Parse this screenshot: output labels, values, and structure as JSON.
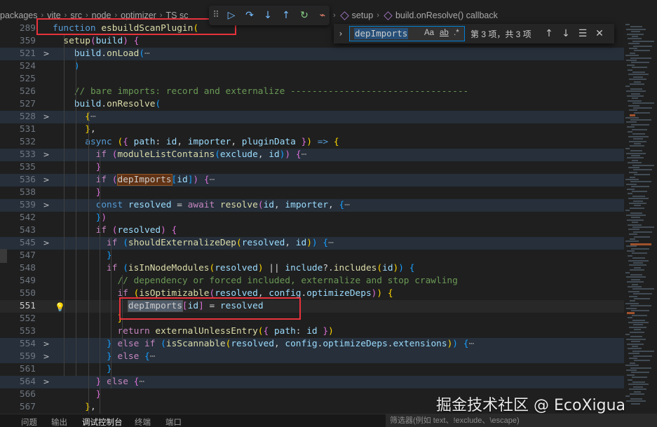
{
  "breadcrumb": {
    "items": [
      "packages",
      "vite",
      "src",
      "node",
      "optimizer",
      "TS sc"
    ],
    "tail": [
      "setup",
      "build.onResolve() callback"
    ]
  },
  "debug_toolbar": {
    "icons": [
      "grip-icon",
      "continue-icon",
      "step-over-icon",
      "step-into-icon",
      "step-out-icon",
      "restart-icon",
      "disconnect-icon"
    ]
  },
  "find": {
    "query": "depImports",
    "match_case": "Aa",
    "whole_word": "ab",
    "regex": ".*",
    "result": "第 3 项，共 3 项"
  },
  "editor": {
    "lines": [
      {
        "num": "289",
        "fold": "",
        "code": [
          [
            "kw",
            "function "
          ],
          [
            "fn",
            "esbuildScanPlugin"
          ],
          [
            "br1",
            "("
          ]
        ]
      },
      {
        "num": "359",
        "fold": "",
        "code": [
          [
            "pl",
            "  "
          ],
          [
            "fn",
            "setup"
          ],
          [
            "br2",
            "("
          ],
          [
            "var",
            "build"
          ],
          [
            "br2",
            ")"
          ],
          [
            "pl",
            " "
          ],
          [
            "br2",
            "{"
          ]
        ]
      },
      {
        "num": "521",
        "fold": ">",
        "folded": true,
        "code": [
          [
            "pl",
            "    "
          ],
          [
            "var",
            "build"
          ],
          [
            "pl",
            "."
          ],
          [
            "fn",
            "onLoad"
          ],
          [
            "br3",
            "("
          ],
          [
            "ellipsis",
            "⋯"
          ]
        ]
      },
      {
        "num": "524",
        "fold": "",
        "code": [
          [
            "pl",
            "    "
          ],
          [
            "br3",
            ")"
          ]
        ]
      },
      {
        "num": "525",
        "fold": "",
        "code": [
          [
            "pl",
            ""
          ]
        ]
      },
      {
        "num": "526",
        "fold": "",
        "code": [
          [
            "pl",
            "    "
          ],
          [
            "cm",
            "// bare imports: record and externalize ---------------------------------"
          ]
        ]
      },
      {
        "num": "527",
        "fold": "",
        "code": [
          [
            "pl",
            "    "
          ],
          [
            "var",
            "build"
          ],
          [
            "pl",
            "."
          ],
          [
            "fn",
            "onResolve"
          ],
          [
            "br3",
            "("
          ]
        ]
      },
      {
        "num": "528",
        "fold": ">",
        "folded": true,
        "code": [
          [
            "pl",
            "      "
          ],
          [
            "br1",
            "{"
          ],
          [
            "ellipsis",
            "⋯"
          ]
        ]
      },
      {
        "num": "531",
        "fold": "",
        "code": [
          [
            "pl",
            "      "
          ],
          [
            "br1",
            "}"
          ],
          [
            "pl",
            ","
          ]
        ]
      },
      {
        "num": "532",
        "fold": "",
        "code": [
          [
            "pl",
            "      "
          ],
          [
            "kw",
            "async"
          ],
          [
            "pl",
            " "
          ],
          [
            "br1",
            "("
          ],
          [
            "br2",
            "{"
          ],
          [
            "pl",
            " "
          ],
          [
            "var",
            "path"
          ],
          [
            "pl",
            ": "
          ],
          [
            "var",
            "id"
          ],
          [
            "pl",
            ", "
          ],
          [
            "var",
            "importer"
          ],
          [
            "pl",
            ", "
          ],
          [
            "var",
            "pluginData"
          ],
          [
            "pl",
            " "
          ],
          [
            "br2",
            "}"
          ],
          [
            "br1",
            ")"
          ],
          [
            "pl",
            " "
          ],
          [
            "kw",
            "=>"
          ],
          [
            "pl",
            " "
          ],
          [
            "br1",
            "{"
          ]
        ]
      },
      {
        "num": "533",
        "fold": ">",
        "folded": true,
        "code": [
          [
            "pl",
            "        "
          ],
          [
            "ctl",
            "if"
          ],
          [
            "pl",
            " "
          ],
          [
            "br2",
            "("
          ],
          [
            "fn",
            "moduleListContains"
          ],
          [
            "br3",
            "("
          ],
          [
            "var",
            "exclude"
          ],
          [
            "pl",
            ", "
          ],
          [
            "var",
            "id"
          ],
          [
            "br3",
            ")"
          ],
          [
            "br2",
            ")"
          ],
          [
            "pl",
            " "
          ],
          [
            "br2",
            "{"
          ],
          [
            "ellipsis",
            "⋯"
          ]
        ]
      },
      {
        "num": "535",
        "fold": "",
        "code": [
          [
            "pl",
            "        "
          ],
          [
            "br2",
            "}"
          ]
        ]
      },
      {
        "num": "536",
        "fold": ">",
        "folded": true,
        "code": [
          [
            "pl",
            "        "
          ],
          [
            "ctl",
            "if"
          ],
          [
            "pl",
            " "
          ],
          [
            "br2",
            "("
          ],
          [
            "hl",
            "depImports"
          ],
          [
            "br3",
            "["
          ],
          [
            "var",
            "id"
          ],
          [
            "br3",
            "]"
          ],
          [
            "br2",
            ")"
          ],
          [
            "pl",
            " "
          ],
          [
            "br2",
            "{"
          ],
          [
            "ellipsis",
            "⋯"
          ]
        ]
      },
      {
        "num": "538",
        "fold": "",
        "code": [
          [
            "pl",
            "        "
          ],
          [
            "br2",
            "}"
          ]
        ]
      },
      {
        "num": "539",
        "fold": ">",
        "folded": true,
        "code": [
          [
            "pl",
            "        "
          ],
          [
            "kw",
            "const"
          ],
          [
            "pl",
            " "
          ],
          [
            "var",
            "resolved"
          ],
          [
            "pl",
            " = "
          ],
          [
            "ctl",
            "await"
          ],
          [
            "pl",
            " "
          ],
          [
            "fn",
            "resolve"
          ],
          [
            "br2",
            "("
          ],
          [
            "var",
            "id"
          ],
          [
            "pl",
            ", "
          ],
          [
            "var",
            "importer"
          ],
          [
            "pl",
            ", "
          ],
          [
            "br3",
            "{"
          ],
          [
            "ellipsis",
            "⋯"
          ]
        ]
      },
      {
        "num": "542",
        "fold": "",
        "code": [
          [
            "pl",
            "        "
          ],
          [
            "br3",
            "}"
          ],
          [
            "br2",
            ")"
          ]
        ]
      },
      {
        "num": "543",
        "fold": "",
        "code": [
          [
            "pl",
            "        "
          ],
          [
            "ctl",
            "if"
          ],
          [
            "pl",
            " "
          ],
          [
            "br2",
            "("
          ],
          [
            "var",
            "resolved"
          ],
          [
            "br2",
            ")"
          ],
          [
            "pl",
            " "
          ],
          [
            "br2",
            "{"
          ]
        ]
      },
      {
        "num": "545",
        "fold": ">",
        "folded": true,
        "code": [
          [
            "pl",
            "          "
          ],
          [
            "ctl",
            "if"
          ],
          [
            "pl",
            " "
          ],
          [
            "br3",
            "("
          ],
          [
            "fn",
            "shouldExternalizeDep"
          ],
          [
            "br1",
            "("
          ],
          [
            "var",
            "resolved"
          ],
          [
            "pl",
            ", "
          ],
          [
            "var",
            "id"
          ],
          [
            "br1",
            ")"
          ],
          [
            "br3",
            ")"
          ],
          [
            "pl",
            " "
          ],
          [
            "br3",
            "{"
          ],
          [
            "ellipsis",
            "⋯"
          ]
        ]
      },
      {
        "num": "547",
        "fold": "",
        "code": [
          [
            "pl",
            "          "
          ],
          [
            "br3",
            "}"
          ]
        ]
      },
      {
        "num": "548",
        "fold": "",
        "code": [
          [
            "pl",
            "          "
          ],
          [
            "ctl",
            "if"
          ],
          [
            "pl",
            " "
          ],
          [
            "br3",
            "("
          ],
          [
            "fn",
            "isInNodeModules"
          ],
          [
            "br1",
            "("
          ],
          [
            "var",
            "resolved"
          ],
          [
            "br1",
            ")"
          ],
          [
            "pl",
            " || "
          ],
          [
            "var",
            "include"
          ],
          [
            "pl",
            "?."
          ],
          [
            "fn",
            "includes"
          ],
          [
            "br1",
            "("
          ],
          [
            "var",
            "id"
          ],
          [
            "br1",
            ")"
          ],
          [
            "br3",
            ")"
          ],
          [
            "pl",
            " "
          ],
          [
            "br3",
            "{"
          ]
        ]
      },
      {
        "num": "549",
        "fold": "",
        "code": [
          [
            "pl",
            "            "
          ],
          [
            "cm",
            "// dependency or forced included, externalize and stop crawling"
          ]
        ]
      },
      {
        "num": "550",
        "fold": "",
        "code": [
          [
            "pl",
            "            "
          ],
          [
            "ctl",
            "if"
          ],
          [
            "pl",
            " "
          ],
          [
            "br1",
            "("
          ],
          [
            "fn",
            "isOptimizable"
          ],
          [
            "br2",
            "("
          ],
          [
            "var",
            "resolved"
          ],
          [
            "pl",
            ", "
          ],
          [
            "var",
            "config"
          ],
          [
            "pl",
            "."
          ],
          [
            "var",
            "optimizeDeps"
          ],
          [
            "br2",
            ")"
          ],
          [
            "br1",
            ")"
          ],
          [
            "pl",
            " "
          ],
          [
            "br1",
            "{"
          ]
        ]
      },
      {
        "num": "551",
        "fold": "",
        "current": true,
        "code": [
          [
            "pl",
            "              "
          ],
          [
            "hl-cur",
            "depImports"
          ],
          [
            "br2",
            "["
          ],
          [
            "var",
            "id"
          ],
          [
            "br2",
            "]"
          ],
          [
            "pl",
            " = "
          ],
          [
            "var",
            "resolved"
          ]
        ]
      },
      {
        "num": "552",
        "fold": "",
        "code": [
          [
            "pl",
            "            "
          ],
          [
            "br1",
            "}"
          ]
        ]
      },
      {
        "num": "553",
        "fold": "",
        "code": [
          [
            "pl",
            "            "
          ],
          [
            "ctl",
            "return"
          ],
          [
            "pl",
            " "
          ],
          [
            "fn",
            "externalUnlessEntry"
          ],
          [
            "br1",
            "("
          ],
          [
            "br2",
            "{"
          ],
          [
            "pl",
            " "
          ],
          [
            "var",
            "path"
          ],
          [
            "pl",
            ": "
          ],
          [
            "var",
            "id"
          ],
          [
            "pl",
            " "
          ],
          [
            "br2",
            "}"
          ],
          [
            "br1",
            ")"
          ]
        ]
      },
      {
        "num": "554",
        "fold": ">",
        "folded": true,
        "code": [
          [
            "pl",
            "          "
          ],
          [
            "br3",
            "}"
          ],
          [
            "pl",
            " "
          ],
          [
            "ctl",
            "else if"
          ],
          [
            "pl",
            " "
          ],
          [
            "br3",
            "("
          ],
          [
            "fn",
            "isScannable"
          ],
          [
            "br1",
            "("
          ],
          [
            "var",
            "resolved"
          ],
          [
            "pl",
            ", "
          ],
          [
            "var",
            "config"
          ],
          [
            "pl",
            "."
          ],
          [
            "var",
            "optimizeDeps"
          ],
          [
            "pl",
            "."
          ],
          [
            "var",
            "extensions"
          ],
          [
            "br1",
            ")"
          ],
          [
            "br3",
            ")"
          ],
          [
            "pl",
            " "
          ],
          [
            "br3",
            "{"
          ],
          [
            "ellipsis",
            "⋯"
          ]
        ]
      },
      {
        "num": "559",
        "fold": ">",
        "folded": true,
        "code": [
          [
            "pl",
            "          "
          ],
          [
            "br3",
            "}"
          ],
          [
            "pl",
            " "
          ],
          [
            "ctl",
            "else"
          ],
          [
            "pl",
            " "
          ],
          [
            "br3",
            "{"
          ],
          [
            "ellipsis",
            "⋯"
          ]
        ]
      },
      {
        "num": "561",
        "fold": "",
        "code": [
          [
            "pl",
            "          "
          ],
          [
            "br3",
            "}"
          ]
        ]
      },
      {
        "num": "564",
        "fold": ">",
        "folded": true,
        "code": [
          [
            "pl",
            "        "
          ],
          [
            "br2",
            "}"
          ],
          [
            "pl",
            " "
          ],
          [
            "ctl",
            "else"
          ],
          [
            "pl",
            " "
          ],
          [
            "br2",
            "{"
          ],
          [
            "ellipsis",
            "⋯"
          ]
        ]
      },
      {
        "num": "566",
        "fold": "",
        "code": [
          [
            "pl",
            "        "
          ],
          [
            "br2",
            "}"
          ]
        ]
      },
      {
        "num": "567",
        "fold": "",
        "code": [
          [
            "pl",
            "      "
          ],
          [
            "br1",
            "}"
          ],
          [
            "pl",
            ","
          ]
        ]
      }
    ]
  },
  "panel": {
    "tabs": [
      "问题",
      "输出",
      "调试控制台",
      "终端",
      "端口"
    ],
    "active_tab": "调试控制台",
    "filter_placeholder": "筛选器(例如 text、!exclude、\\escape)"
  },
  "watermark": "掘金技术社区 @ EcoXigua",
  "colors": {
    "annotation_box": "#e8323c",
    "find_border": "#007fd4",
    "match_highlight": "#613214"
  }
}
